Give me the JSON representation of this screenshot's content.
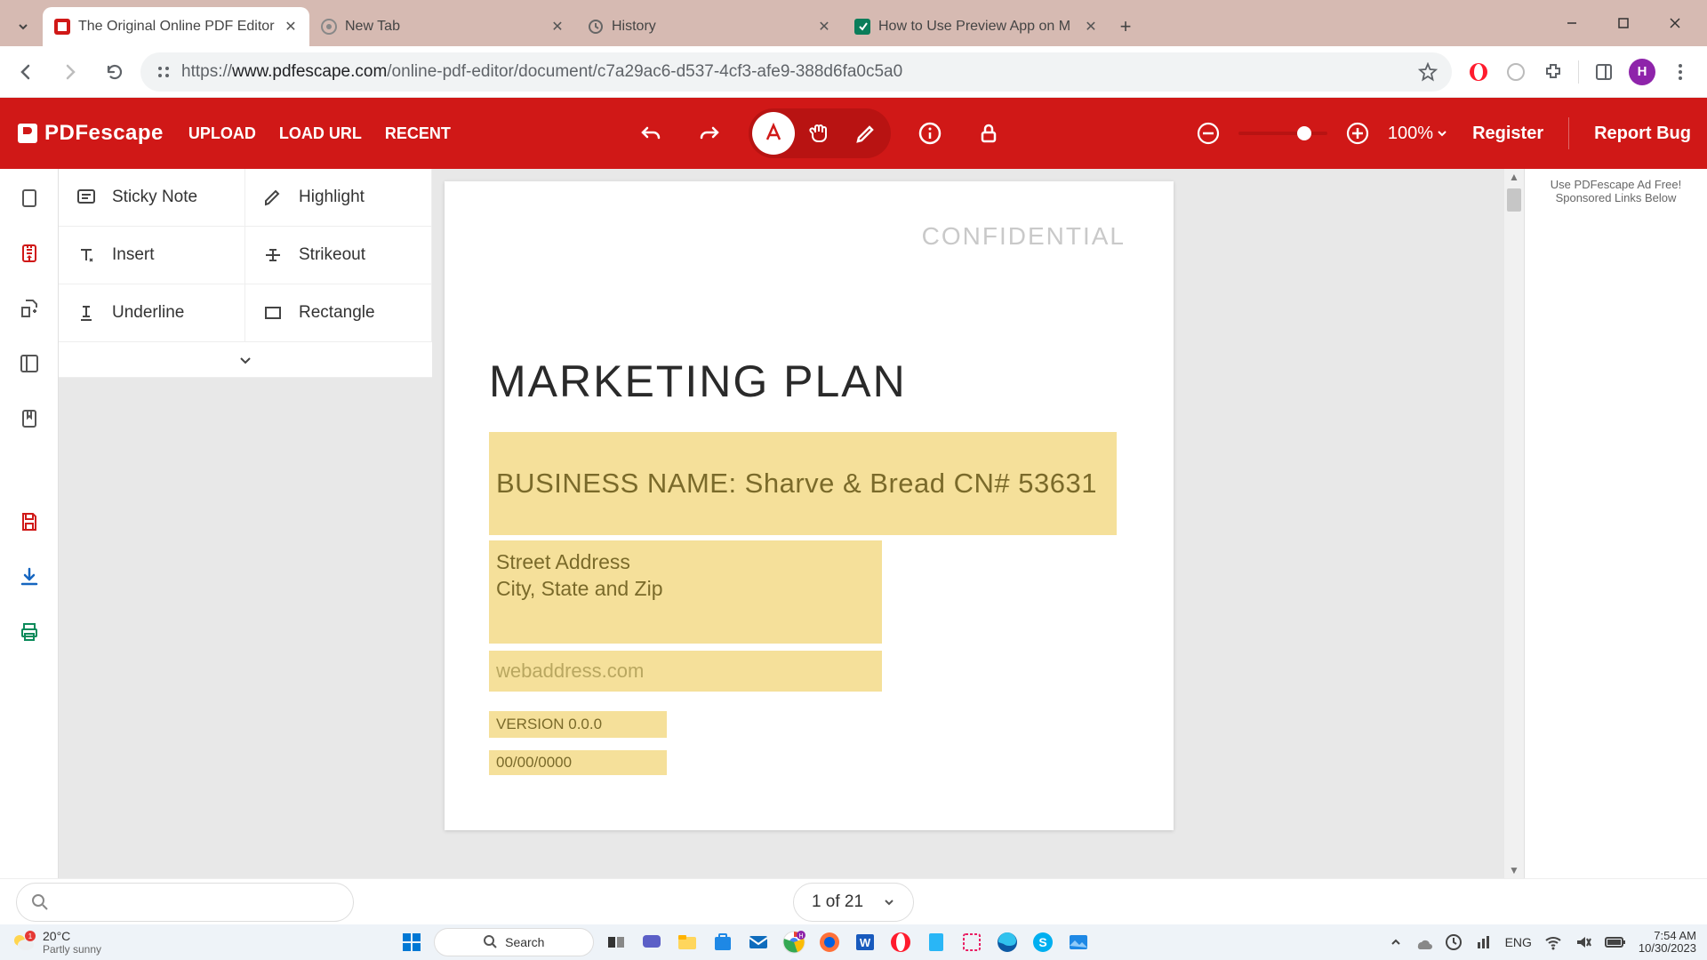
{
  "browser": {
    "tabs": [
      {
        "title": "The Original Online PDF Editor",
        "favicon": "pdf"
      },
      {
        "title": "New Tab",
        "favicon": "chrome"
      },
      {
        "title": "History",
        "favicon": "history"
      },
      {
        "title": "How to Use Preview App on M",
        "favicon": "guide"
      }
    ],
    "url_prefix": "https://",
    "url_domain": "www.pdfescape.com",
    "url_path": "/online-pdf-editor/document/c7a29ac6-d537-4cf3-afe9-388d6fa0c5a0",
    "profile_initial": "H"
  },
  "app": {
    "logo": "PDFescape",
    "menu": {
      "upload": "UPLOAD",
      "load_url": "LOAD URL",
      "recent": "RECENT"
    },
    "zoom": "100%",
    "register": "Register",
    "report_bug": "Report Bug"
  },
  "tools": {
    "sticky_note": "Sticky Note",
    "highlight": "Highlight",
    "insert": "Insert",
    "strikeout": "Strikeout",
    "underline": "Underline",
    "rectangle": "Rectangle"
  },
  "document": {
    "watermark": "CONFIDENTIAL",
    "title": "MARKETING PLAN",
    "business_line": "BUSINESS NAME: Sharve & Bread CN# 53631",
    "addr1": "Street Address",
    "addr2": "City, State and Zip",
    "web": "webaddress.com",
    "version": "VERSION 0.0.0",
    "date": "00/00/0000"
  },
  "ad": {
    "line1": "Use PDFescape Ad Free!",
    "line2": "Sponsored Links Below"
  },
  "pager": {
    "label": "1 of 21"
  },
  "taskbar": {
    "temp": "20°C",
    "cond": "Partly sunny",
    "search": "Search",
    "lang": "ENG",
    "time": "7:54 AM",
    "date": "10/30/2023"
  }
}
